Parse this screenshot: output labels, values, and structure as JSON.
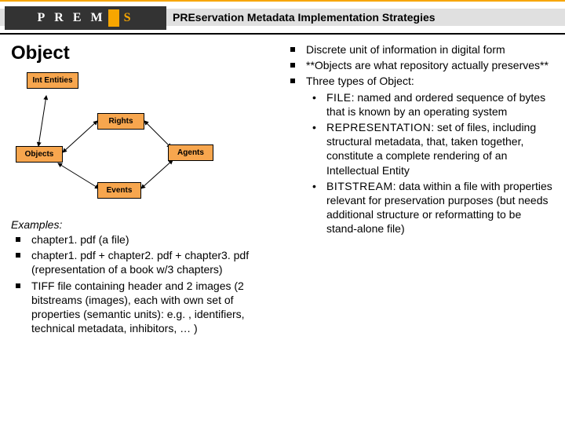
{
  "header": {
    "logo_letters": "P R E M",
    "brand": "PREservation Metadata Implementation Strategies",
    "brand_prefix": "PRE",
    "brand_rest": "servation Metadata Implementation Strategies"
  },
  "title": "Object",
  "diagram": {
    "int_entities": "Int Entities",
    "rights": "Rights",
    "objects": "Objects",
    "agents": "Agents",
    "events": "Events"
  },
  "examples_heading": "Examples:",
  "examples": [
    "chapter1. pdf (a file)",
    "chapter1. pdf + chapter2. pdf + chapter3. pdf (representation of a book w/3 chapters)",
    "TIFF file containing header and 2 images (2 bitstreams (images), each with own set of properties (semantic units): e.g. , identifiers, technical metadata, inhibitors, … )"
  ],
  "bullets": [
    "Discrete unit of information in digital form",
    "**Objects are what repository actually preserves**",
    "Three types of Object:"
  ],
  "types": [
    {
      "term": "FILE",
      "rest": ": named and ordered sequence of bytes that is known by an operating system"
    },
    {
      "term": "REPRESENTATION",
      "rest": ": set of files, including structural metadata, that, taken together, constitute a complete rendering of an Intellectual Entity"
    },
    {
      "term": "BITSTREAM",
      "rest": ": data within a file with properties relevant for preservation purposes (but needs additional structure or reformatting to be stand-alone file)"
    }
  ]
}
